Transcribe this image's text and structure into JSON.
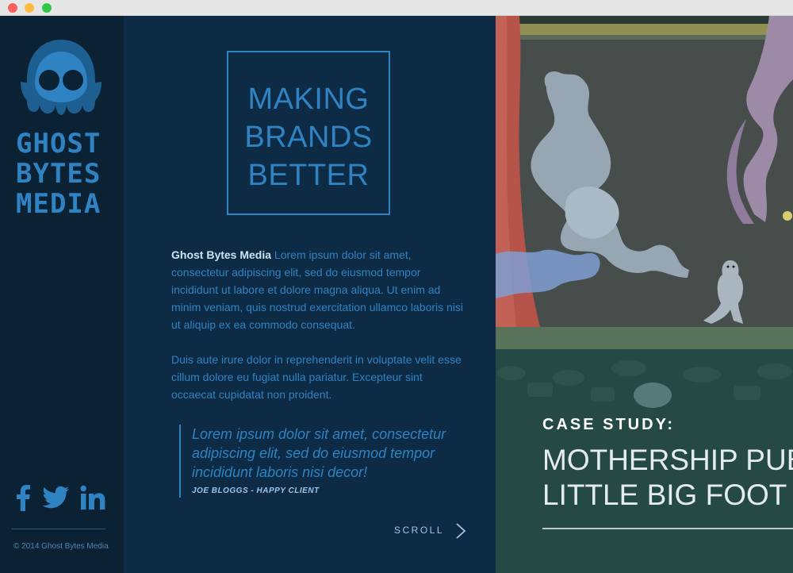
{
  "window": {
    "controls": [
      "close",
      "minimize",
      "zoom"
    ]
  },
  "brand": {
    "logo_lines": [
      "GHOST",
      "BYTES",
      "MEDIA"
    ],
    "logo_icon": "ghost-icon",
    "color": "#2f83c2"
  },
  "social": [
    {
      "name": "facebook",
      "icon": "facebook-icon"
    },
    {
      "name": "twitter",
      "icon": "twitter-icon"
    },
    {
      "name": "linkedin",
      "icon": "linkedin-icon"
    }
  ],
  "footer": {
    "copyright": "© 2014 Ghost Bytes Media"
  },
  "tagline": {
    "lines": [
      "MAKING",
      "BRANDS",
      "BETTER"
    ]
  },
  "intro": {
    "brand_name": "Ghost Bytes Media",
    "paragraph1": " Lorem ipsum dolor sit amet, consectetur adipiscing elit, sed do eiusmod tempor incididunt ut labore et dolore magna aliqua. Ut enim ad minim veniam, quis nostrud exercitation ullamco laboris nisi ut aliquip ex ea commodo consequat.",
    "paragraph2": "Duis aute irure dolor in reprehenderit in voluptate velit esse cillum dolore eu fugiat nulla pariatur. Excepteur sint occaecat cupidatat non proident."
  },
  "testimonial": {
    "quote": "Lorem ipsum dolor sit amet, consectetur adipiscing elit, sed do eiusmod tempor incididunt laboris nisi decor!",
    "author": "JOE BLOGGS - HAPPY CLIENT"
  },
  "scroll": {
    "label": "SCROLL",
    "icon": "chevron-right-icon"
  },
  "case_study": {
    "label": "CASE STUDY:",
    "title_lines": [
      "MOTHERSHIP PUBL",
      "LITTLE BIG FOOT"
    ]
  },
  "colors": {
    "sidebar_bg": "#0b2235",
    "middle_bg": "#0d2b45",
    "accent": "#2f83c2",
    "hero_overlay": "#1e4845"
  }
}
